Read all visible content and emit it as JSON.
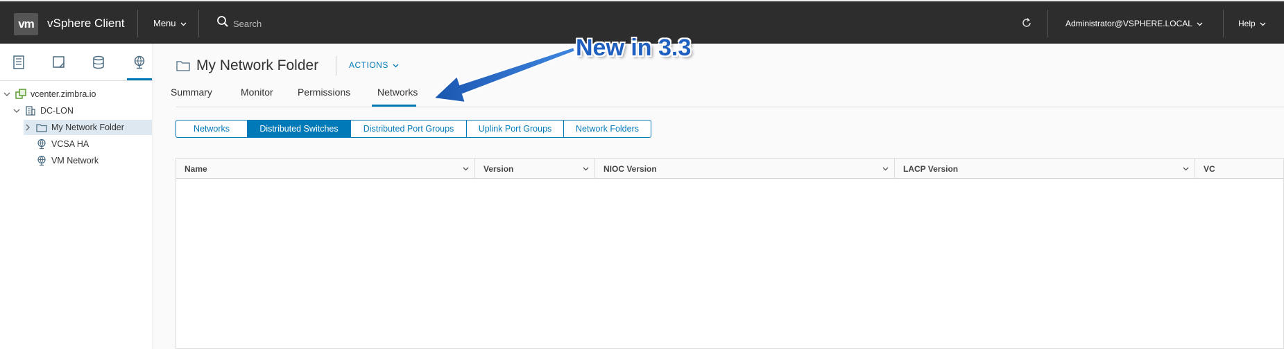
{
  "header": {
    "logo": "vm",
    "app_title": "vSphere Client",
    "menu_label": "Menu",
    "search_label": "Search",
    "user_label": "Administrator@VSPHERE.LOCAL",
    "help_label": "Help"
  },
  "sidebar": {
    "tabs": [
      {
        "icon": "hosts-clusters-icon"
      },
      {
        "icon": "vms-templates-icon"
      },
      {
        "icon": "storage-icon"
      },
      {
        "icon": "networking-icon",
        "active": true
      }
    ],
    "tree": [
      {
        "label": "vcenter.zimbra.io",
        "icon": "vcenter-icon"
      },
      {
        "label": "DC-LON",
        "icon": "datacenter-icon"
      },
      {
        "label": "My Network Folder",
        "icon": "folder-icon",
        "selected": true
      },
      {
        "label": "VCSA HA",
        "icon": "network-icon"
      },
      {
        "label": "VM Network",
        "icon": "network-icon"
      }
    ]
  },
  "main": {
    "title": "My Network Folder",
    "actions_label": "ACTIONS",
    "tabs": [
      {
        "label": "Summary"
      },
      {
        "label": "Monitor"
      },
      {
        "label": "Permissions"
      },
      {
        "label": "Networks",
        "active": true
      }
    ],
    "segments": [
      {
        "label": "Networks"
      },
      {
        "label": "Distributed Switches",
        "active": true
      },
      {
        "label": "Distributed Port Groups"
      },
      {
        "label": "Uplink Port Groups"
      },
      {
        "label": "Network Folders"
      }
    ],
    "grid": {
      "columns": [
        {
          "label": "Name"
        },
        {
          "label": "Version"
        },
        {
          "label": "NIOC Version"
        },
        {
          "label": "LACP Version"
        },
        {
          "label": "VC"
        }
      ]
    }
  },
  "annotation": {
    "text": "New in 3.3",
    "color": "#1f5fbf"
  },
  "colors": {
    "accent": "#0079b8",
    "header_bg": "#2d2d2d"
  }
}
